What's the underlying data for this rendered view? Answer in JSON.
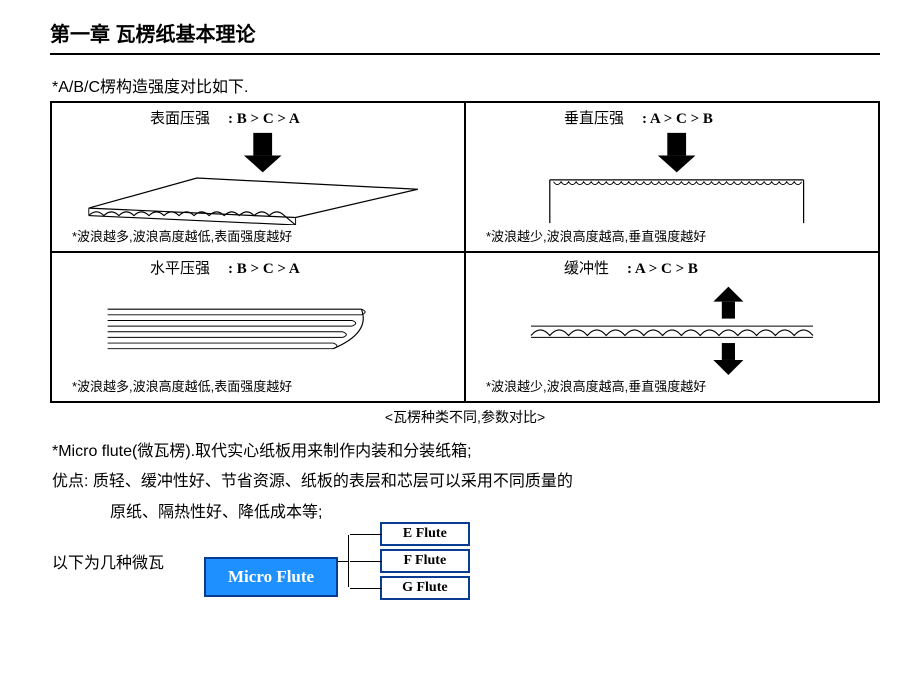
{
  "chapter_title": "第一章 瓦楞纸基本理论",
  "subtitle": "*A/B/C楞构造强度对比如下.",
  "cells": {
    "top_left": {
      "label": "表面压强",
      "rank": ": B > C > A",
      "note": "*波浪越多,波浪高度越低,表面强度越好"
    },
    "top_right": {
      "label": "垂直压强",
      "rank": ": A > C > B",
      "note": "*波浪越少,波浪高度越高,垂直强度越好"
    },
    "bottom_left": {
      "label": "水平压强",
      "rank": ": B > C > A",
      "note": "*波浪越多,波浪高度越低,表面强度越好"
    },
    "bottom_right": {
      "label": "缓冲性",
      "rank": ": A > C > B",
      "note": "*波浪越少,波浪高度越高,垂直强度越好"
    }
  },
  "caption": "<瓦楞种类不同,参数对比>",
  "body": {
    "line1": "*Micro flute(微瓦楞).取代实心纸板用来制作内装和分装纸箱;",
    "line2": "优点: 质轻、缓冲性好、节省资源、纸板的表层和芯层可以采用不同质量的",
    "line3": "原纸、隔热性好、降低成本等;",
    "line4": "以下为几种微瓦"
  },
  "micro": {
    "main": "Micro Flute",
    "types": [
      "E  Flute",
      "F  Flute",
      "G  Flute"
    ]
  }
}
